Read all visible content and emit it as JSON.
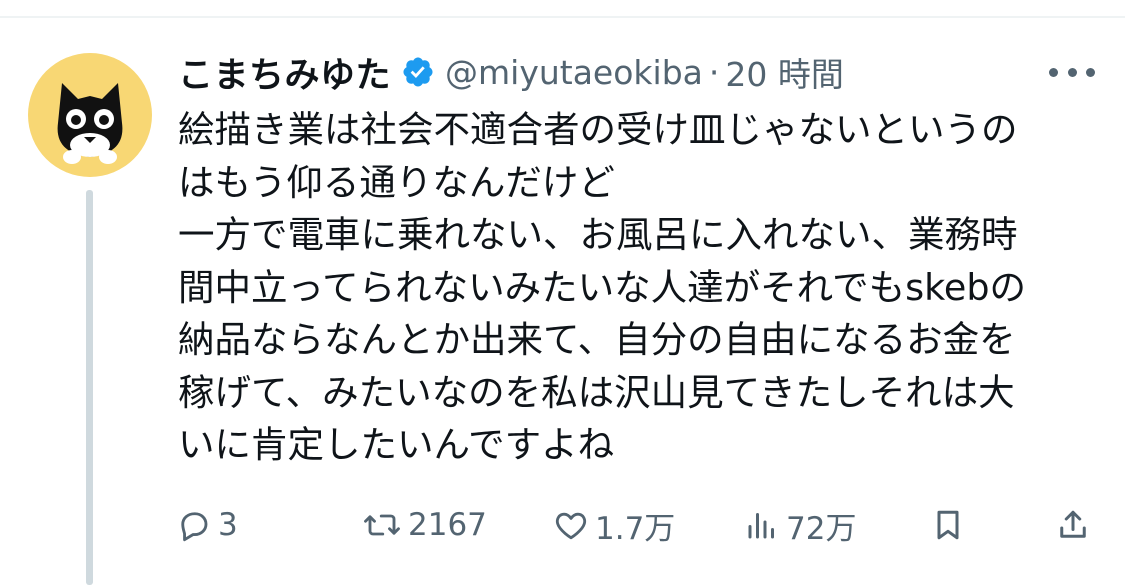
{
  "tweet": {
    "author": {
      "display_name": "こまちみゆた",
      "handle": "@miyutaeokiba",
      "separator": "·",
      "time": "20 時間",
      "verified": true,
      "avatar_icon": "black-cat-avatar"
    },
    "text_lines": [
      "絵描き業は社会不適合者の受け皿じゃないというの",
      "はもう仰る通りなんだけど",
      "一方で電車に乗れない、お風呂に入れない、業務時",
      "間中立ってられないみたいな人達がそれでもskebの",
      "納品ならなんとか出来て、自分の自由になるお金を",
      "稼げて、みたいなのを私は沢山見てきたしそれは大",
      "いに肯定したいんですよね"
    ],
    "actions": {
      "reply_count": "3",
      "retweet_count": "2167",
      "like_count": "1.7万",
      "views_count": "72万"
    }
  },
  "colors": {
    "text": "#0f1419",
    "secondary": "#536471",
    "verified_badge": "#1d9bf0",
    "avatar_bg": "#f8d774",
    "thread_line": "#cfd9de"
  }
}
